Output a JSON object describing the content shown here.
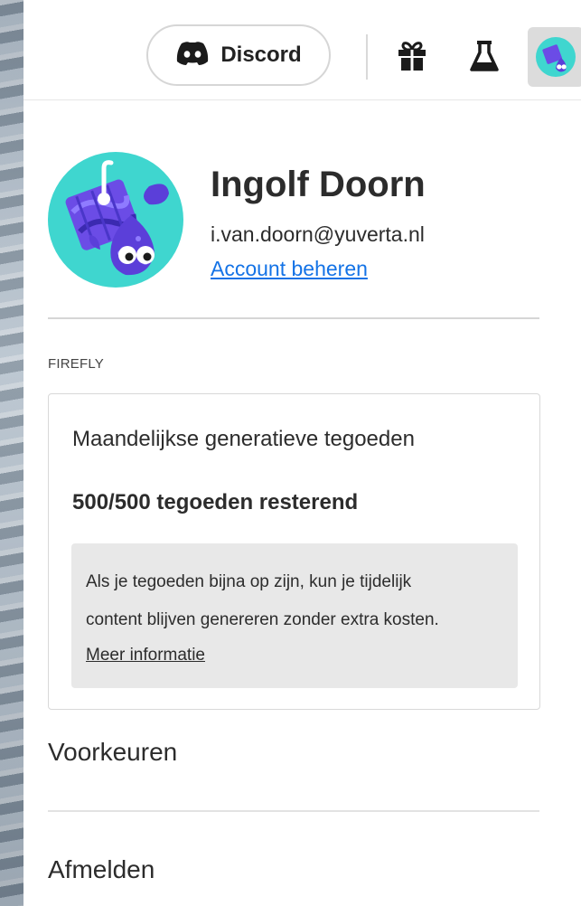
{
  "topbar": {
    "discord_label": "Discord",
    "icons": [
      "discord-icon",
      "gift-icon",
      "flask-icon",
      "avatar"
    ]
  },
  "profile": {
    "name": "Ingolf Doorn",
    "email": "i.van.doorn@yuverta.nl",
    "manage_link": "Account beheren"
  },
  "firefly": {
    "section_label": "FIREFLY",
    "credits_title": "Maandelijkse generatieve tegoeden",
    "credits_remaining": "500/500 tegoeden resterend",
    "info_line1": "Als je tegoeden bijna op zijn, kun je tijdelijk",
    "info_line2": "content blijven genereren zonder extra kosten.",
    "more_link": "Meer informatie"
  },
  "menu": {
    "preferences": "Voorkeuren",
    "sign_out": "Afmelden"
  },
  "colors": {
    "link": "#1473e6",
    "avatar_bg": "#3fd6cf",
    "avatar_accent": "#5b3fd9"
  }
}
